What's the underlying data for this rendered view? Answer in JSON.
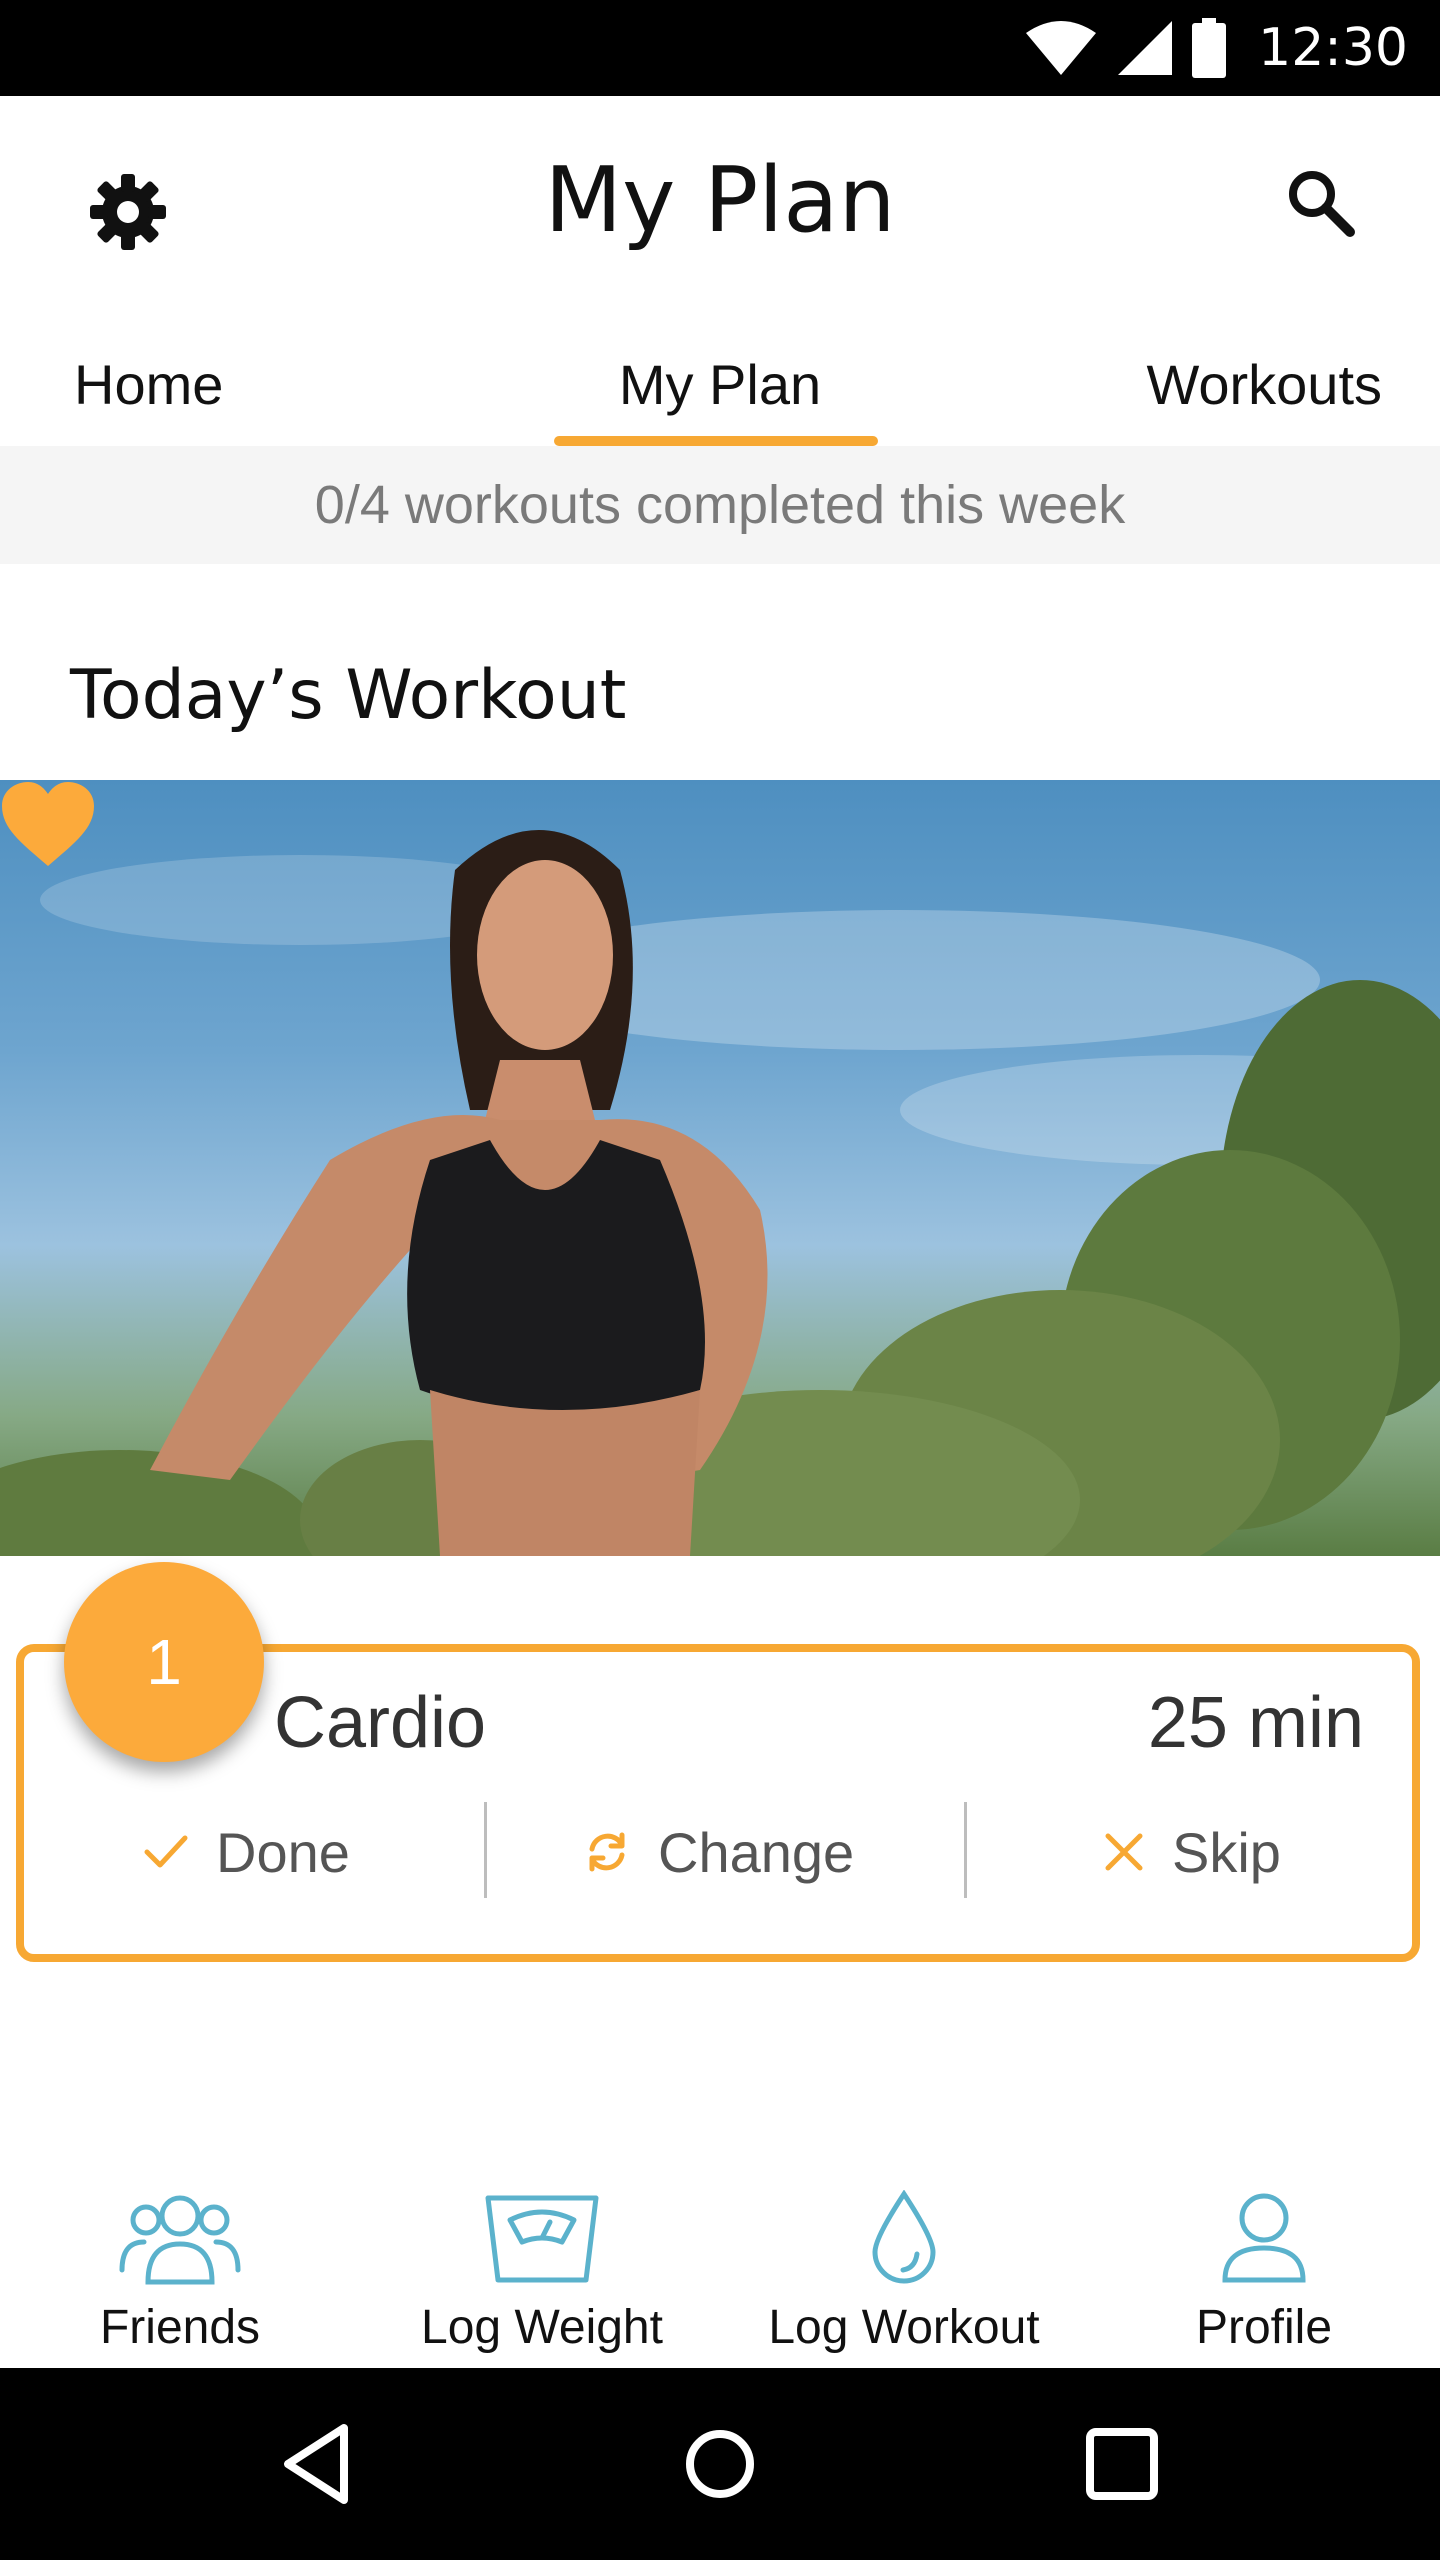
{
  "status_bar": {
    "time": "12:30",
    "icons": [
      "wifi-icon",
      "signal-icon",
      "battery-icon"
    ]
  },
  "app_bar": {
    "title": "My Plan",
    "left_icon": "gear-icon",
    "right_icon": "search-icon"
  },
  "tabs": [
    {
      "label": "Home",
      "active": false
    },
    {
      "label": "My Plan",
      "active": true
    },
    {
      "label": "Workouts",
      "active": false
    }
  ],
  "progress_text": "0/4 workouts completed this week",
  "section_title": "Today’s Workout",
  "hero": {
    "favorite_icon": "heart-icon",
    "favorite": true
  },
  "workout_card": {
    "badge": "1",
    "name": "Cardio",
    "duration": "25 min",
    "actions": [
      {
        "label": "Done",
        "icon": "check-icon"
      },
      {
        "label": "Change",
        "icon": "refresh-icon"
      },
      {
        "label": "Skip",
        "icon": "close-icon"
      }
    ]
  },
  "bottom_nav": [
    {
      "label": "Friends",
      "icon": "friends-icon"
    },
    {
      "label": "Log Weight",
      "icon": "scale-icon"
    },
    {
      "label": "Log Workout",
      "icon": "drop-icon"
    },
    {
      "label": "Profile",
      "icon": "profile-icon"
    }
  ],
  "colors": {
    "accent": "#f7a833",
    "icon_teal": "#5bb2cc",
    "status_bg": "#000000"
  }
}
